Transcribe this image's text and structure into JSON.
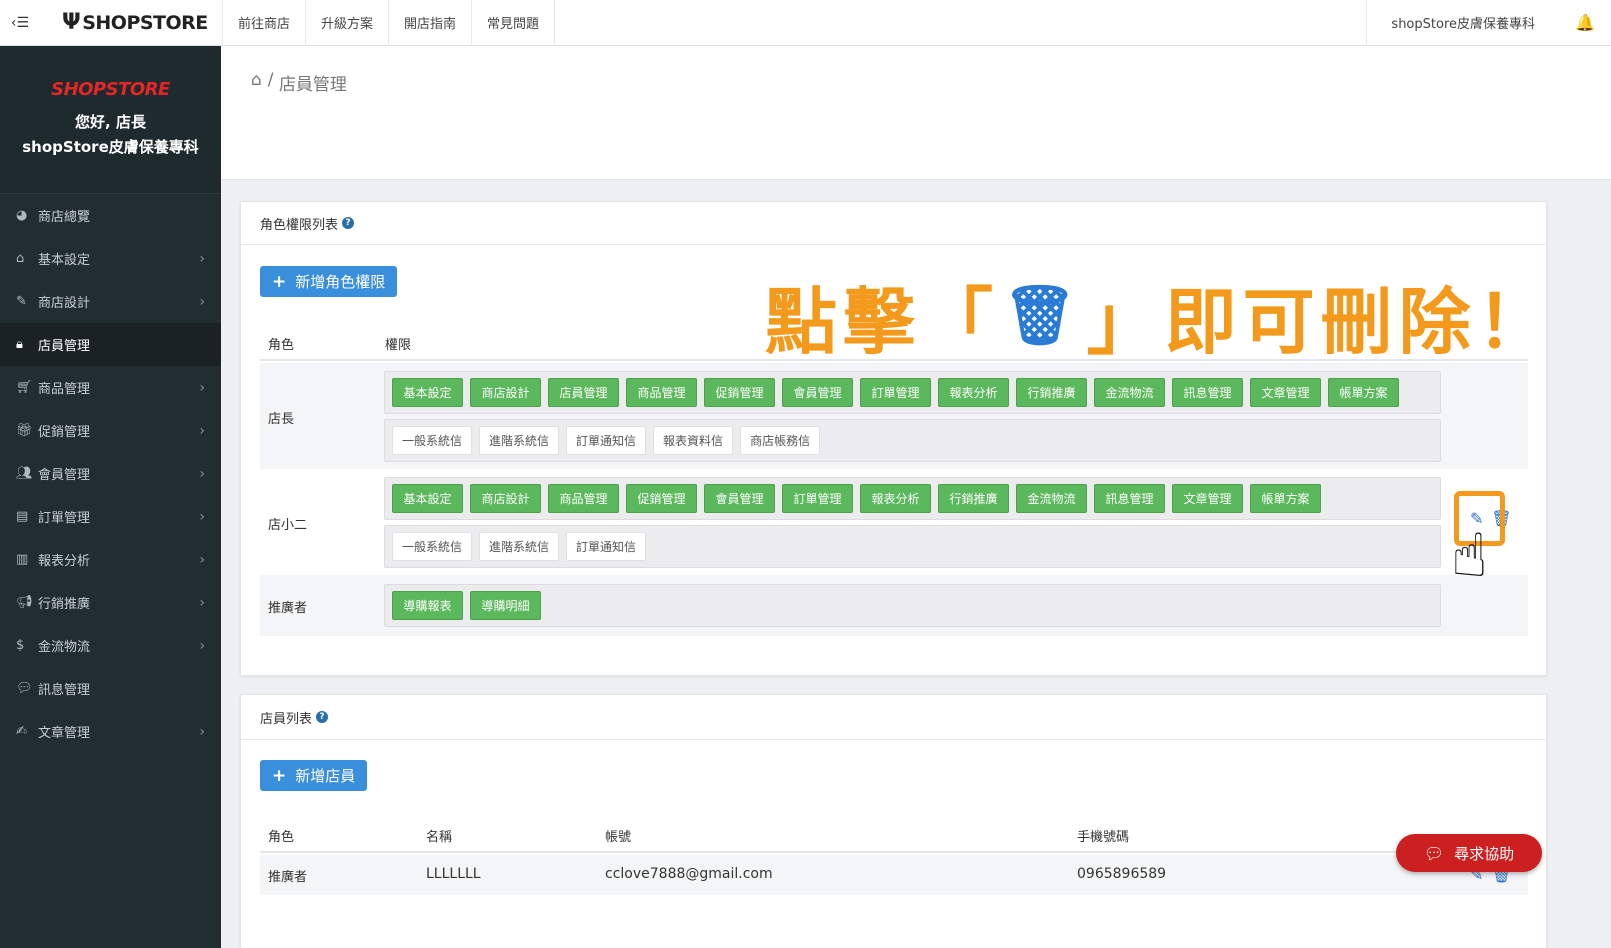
{
  "topbar": {
    "brand": "SHOPSTORE",
    "nav": [
      "前往商店",
      "升級方案",
      "開店指南",
      "常見問題"
    ],
    "store_name": "shopStore皮膚保養專科"
  },
  "sidebar": {
    "logo": "SHOPSTORE",
    "greeting": "您好, 店長",
    "store": "shopStore皮膚保養專科",
    "items": [
      {
        "label": "商店總覽",
        "icon": "dashboard-icon",
        "arrow": false
      },
      {
        "label": "基本設定",
        "icon": "bank-icon",
        "arrow": true
      },
      {
        "label": "商店設計",
        "icon": "magic-wand-icon",
        "arrow": true
      },
      {
        "label": "店員管理",
        "icon": "user-lock-icon",
        "arrow": false,
        "active": true
      },
      {
        "label": "商品管理",
        "icon": "cart-icon",
        "arrow": true
      },
      {
        "label": "促銷管理",
        "icon": "gift-icon",
        "arrow": true
      },
      {
        "label": "會員管理",
        "icon": "users-icon",
        "arrow": true
      },
      {
        "label": "訂單管理",
        "icon": "document-icon",
        "arrow": true
      },
      {
        "label": "報表分析",
        "icon": "bar-chart-icon",
        "arrow": true
      },
      {
        "label": "行銷推廣",
        "icon": "megaphone-icon",
        "arrow": true
      },
      {
        "label": "金流物流",
        "icon": "dollar-icon",
        "arrow": true
      },
      {
        "label": "訊息管理",
        "icon": "chat-icon",
        "arrow": false
      },
      {
        "label": "文章管理",
        "icon": "edit-icon",
        "arrow": true
      }
    ]
  },
  "breadcrumb": {
    "current": "店員管理"
  },
  "roles_card": {
    "title": "角色權限列表",
    "add_button": "新增角色權限",
    "headers": [
      "角色",
      "權限"
    ],
    "rows": [
      {
        "role": "店長",
        "perms": [
          "基本設定",
          "商店設計",
          "店員管理",
          "商品管理",
          "促銷管理",
          "會員管理",
          "訂單管理",
          "報表分析",
          "行銷推廣",
          "金流物流",
          "訊息管理",
          "文章管理",
          "帳單方案"
        ],
        "mails": [
          "一般系統信",
          "進階系統信",
          "訂單通知信",
          "報表資料信",
          "商店帳務信"
        ]
      },
      {
        "role": "店小二",
        "perms": [
          "基本設定",
          "商店設計",
          "商品管理",
          "促銷管理",
          "會員管理",
          "訂單管理",
          "報表分析",
          "行銷推廣",
          "金流物流",
          "訊息管理",
          "文章管理",
          "帳單方案"
        ],
        "mails": [
          "一般系統信",
          "進階系統信",
          "訂單通知信"
        ]
      },
      {
        "role": "推廣者",
        "perms": [
          "導購報表",
          "導購明細"
        ],
        "mails": []
      }
    ]
  },
  "callout": {
    "before": "點擊「",
    "after": "」即可刪除！"
  },
  "staff_card": {
    "title": "店員列表",
    "add_button": "新增店員",
    "headers": [
      "角色",
      "名稱",
      "帳號",
      "手機號碼"
    ],
    "rows": [
      {
        "role": "推廣者",
        "name": "LLLLLLL",
        "account": "cclove7888@gmail.com",
        "phone": "0965896589"
      }
    ]
  },
  "help_button": "尋求協助"
}
